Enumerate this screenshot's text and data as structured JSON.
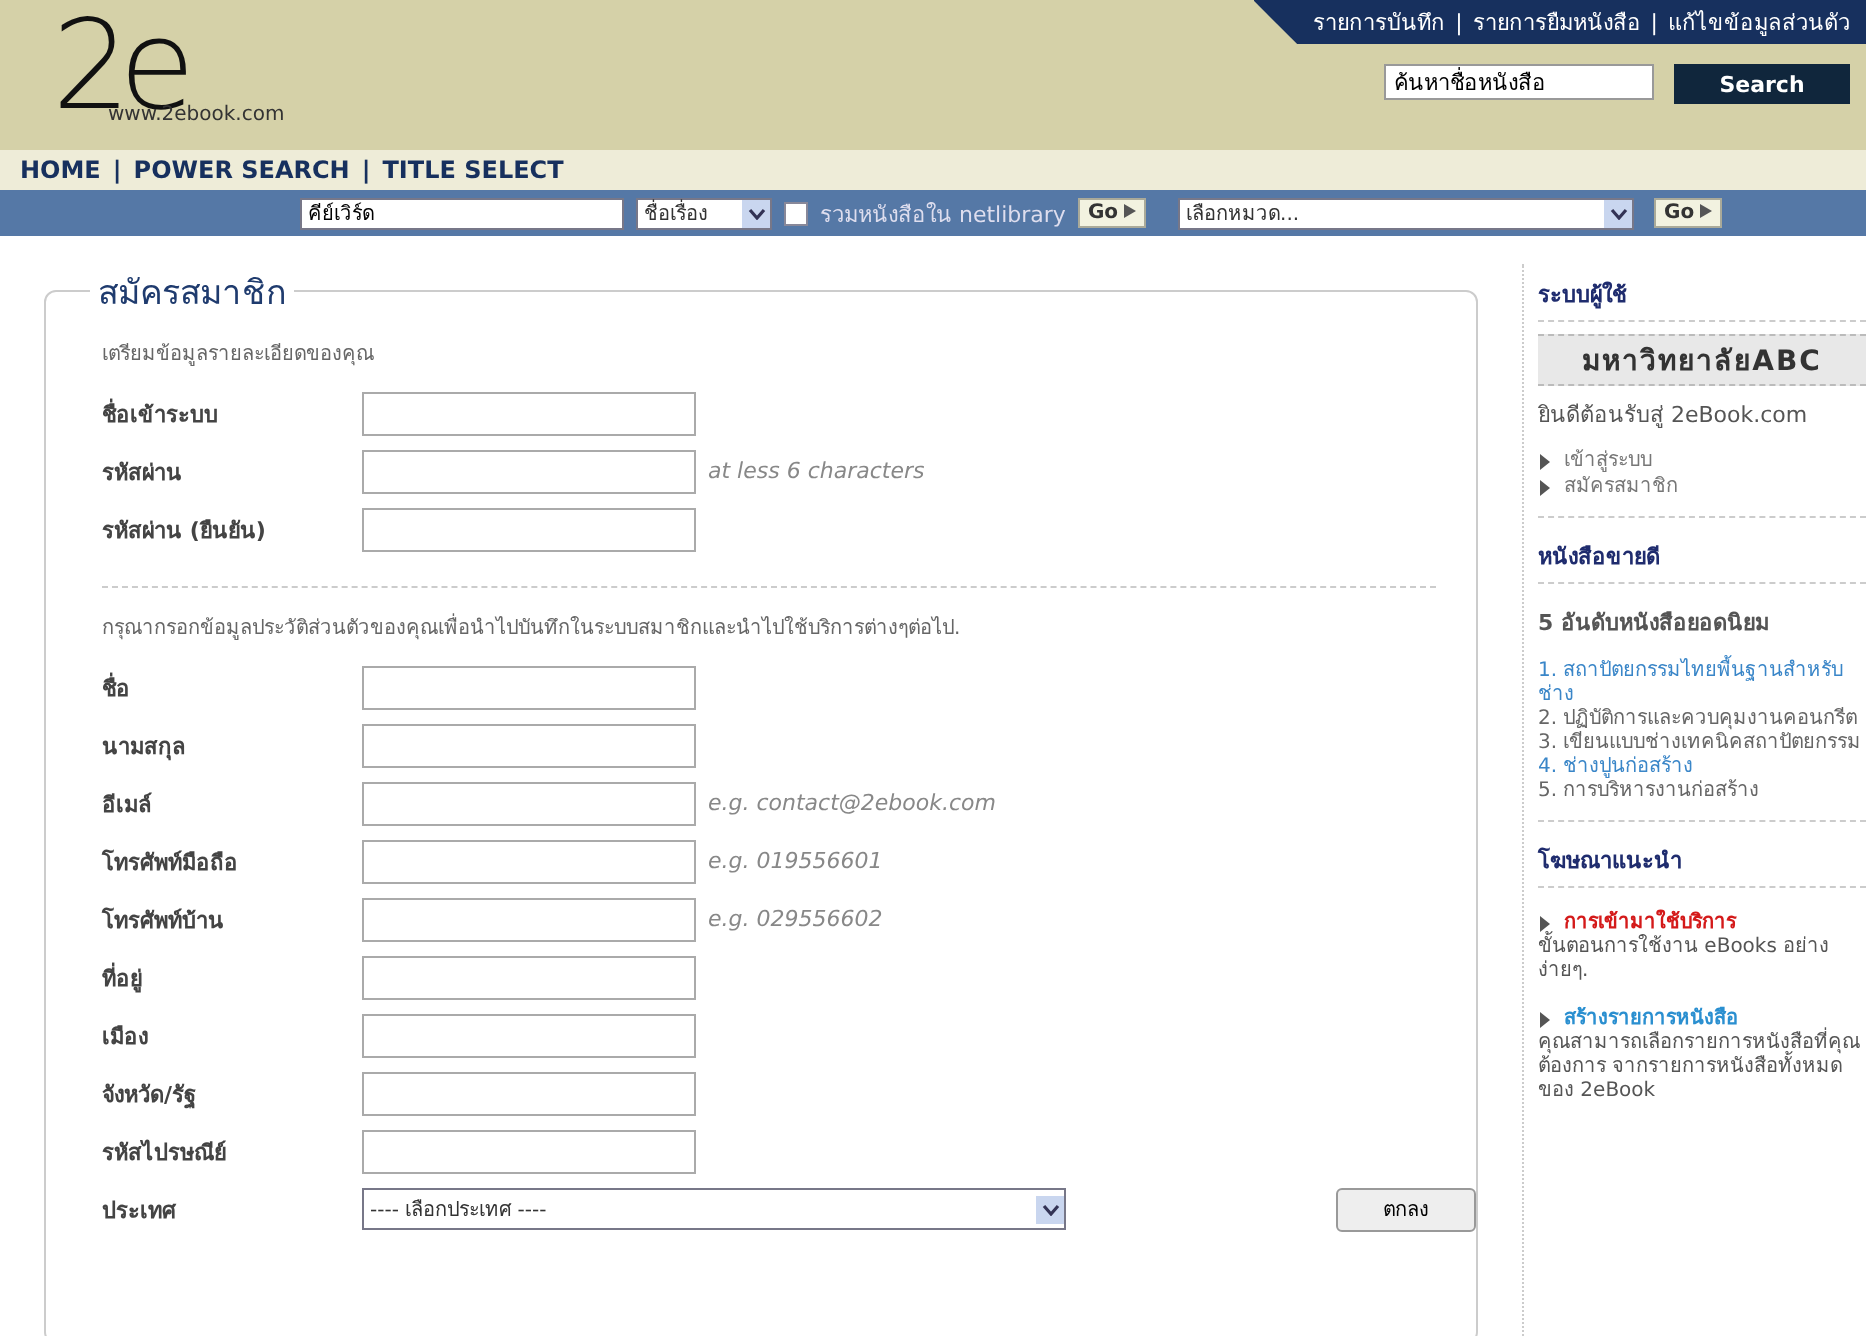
{
  "logo": {
    "mark": "2e",
    "site": "www.2ebook.com"
  },
  "top_links": {
    "items": [
      "รายการบันทึก",
      "รายการยืมหนังสือ",
      "แก้ไขข้อมูลส่วนตัว"
    ],
    "separator": "|"
  },
  "header_search": {
    "value": "ค้นหาชื่อหนังสือ",
    "button": "Search"
  },
  "nav": {
    "items": [
      "HOME",
      "POWER SEARCH",
      "TITLE SELECT"
    ],
    "separator": "|"
  },
  "search_bar": {
    "keyword": "คีย์เวิร์ด",
    "field_select": "ชื่อเรื่อง",
    "netlibrary": {
      "label": "รวมหนังสือใน netlibrary",
      "checked": false
    },
    "go_button": "Go",
    "category_select": "เลือกหมวด...",
    "go_button_2": "Go"
  },
  "form": {
    "title": "สมัครสมาชิก",
    "section_1_intro": "เตรียมข้อมูลรายละเอียดของคุณ",
    "section_1_fields": [
      {
        "label": "ชื่อเข้าระบบ"
      },
      {
        "label": "รหัสผ่าน",
        "hint": "at less 6 characters"
      },
      {
        "label": "รหัสผ่าน (ยืนยัน)"
      }
    ],
    "section_2_intro": "กรุณากรอกข้อมูลประวัติส่วนตัวของคุณเพื่อนำไปบันทึกในระบบสมาชิกและนำไปใช้บริการต่างๆต่อไป.",
    "section_2_fields": [
      {
        "label": "ชื่อ",
        "kind": "text"
      },
      {
        "label": "นามสกุล",
        "kind": "text"
      },
      {
        "label": "อีเมล์",
        "kind": "text",
        "hint": "e.g. contact@2ebook.com"
      },
      {
        "label": "โทรศัพท์มือถือ",
        "kind": "text",
        "hint": "e.g. 019556601"
      },
      {
        "label": "โทรศัพท์บ้าน",
        "kind": "text",
        "hint": "e.g. 029556602"
      },
      {
        "label": "ที่อยู่",
        "kind": "text"
      },
      {
        "label": "เมือง",
        "kind": "text"
      },
      {
        "label": "จังหวัด/รัฐ",
        "kind": "text"
      },
      {
        "label": "รหัสไปรษณีย์",
        "kind": "text"
      },
      {
        "label": "ประเทศ",
        "kind": "select",
        "value": "---- เลือกประเทศ ----"
      }
    ],
    "submit": "ตกลง"
  },
  "sidebar": {
    "user_heading": "ระบบผู้ใช้",
    "institution": "มหาวิทยาลัยABC",
    "welcome": "ยินดีต้อนรับสู่ 2eBook.com",
    "user_links": [
      "เข้าสู่ระบบ",
      "สมัครสมาชิก"
    ],
    "bestseller_heading": "หนังสือขายดี",
    "bestseller_subheading": "5 อันดับหนังสือยอดนิยม",
    "bestsellers": [
      {
        "text": "1. สถาปัตยกรรมไทยพื้นฐานสำหรับช่าง",
        "color": "#3a86c8"
      },
      {
        "text": "2. ปฏิบัติการและควบคุมงานคอนกรีต",
        "color": "#666666"
      },
      {
        "text": "3. เขียนแบบช่างเทคนิคสถาปัตยกรรม",
        "color": "#666666"
      },
      {
        "text": "4. ช่างปูนก่อสร้าง",
        "color": "#3a86c8"
      },
      {
        "text": "5. การบริหารงานก่อสร้าง",
        "color": "#666666"
      }
    ],
    "ads_heading": "โฆษณาแนะนำ",
    "ads": [
      {
        "title": "การเข้ามาใช้บริการ",
        "color": "#d41a1a",
        "text": "ขั้นตอนการใช้งาน eBooks อย่างง่ายๆ."
      },
      {
        "title": "สร้างรายการหนังสือ",
        "color": "#2a8fd0",
        "text": "คุณสามารถเลือกรายการหนังสือที่คุณต้องการ จากรายการหนังสือทั้งหมดของ 2eBook"
      }
    ]
  }
}
